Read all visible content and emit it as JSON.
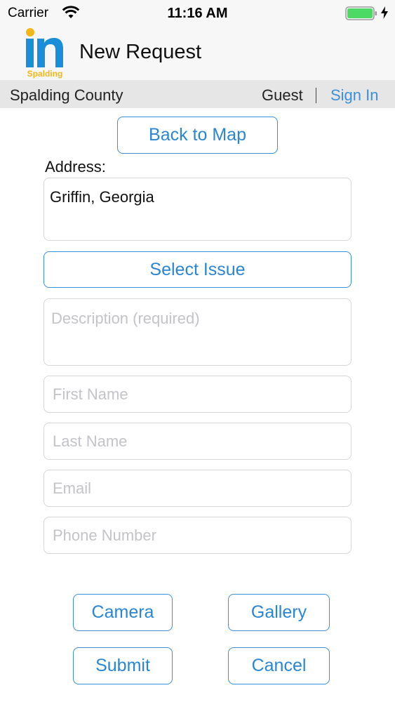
{
  "status_bar": {
    "carrier": "Carrier",
    "time": "11:16 AM"
  },
  "nav": {
    "logo_text": "in",
    "logo_subtext": "Spalding",
    "title": "New Request"
  },
  "sub_bar": {
    "county": "Spalding County",
    "user": "Guest",
    "sign_in": "Sign In"
  },
  "form": {
    "back_button": "Back to Map",
    "address_label": "Address:",
    "address_value": "Griffin, Georgia",
    "select_issue_button": "Select Issue",
    "description_placeholder": "Description (required)",
    "first_name_placeholder": "First Name",
    "last_name_placeholder": "Last Name",
    "email_placeholder": "Email",
    "phone_placeholder": "Phone Number"
  },
  "actions": {
    "camera": "Camera",
    "gallery": "Gallery",
    "submit": "Submit",
    "cancel": "Cancel"
  },
  "colors": {
    "accent": "#2a86d4",
    "logo_blue": "#1a8fd8",
    "logo_yellow": "#f2b619",
    "battery_green": "#4cd964"
  }
}
